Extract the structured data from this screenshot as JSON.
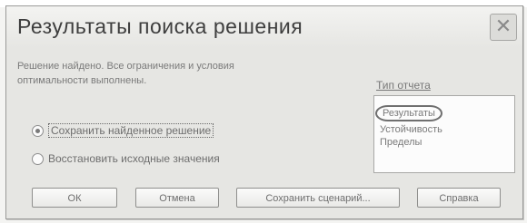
{
  "dialog": {
    "title": "Результаты поиска решения",
    "close_glyph": "✕",
    "message_line1": "Решение найдено. Все ограничения и условия",
    "message_line2": "оптимальности выполнены."
  },
  "options": {
    "keep_solution": "Сохранить найденное решение",
    "restore_values": "Восстановить исходные значения",
    "selected": "keep_solution"
  },
  "report": {
    "label": "Тип отчета",
    "items": [
      "Результаты",
      "Устойчивость",
      "Пределы"
    ]
  },
  "buttons": {
    "ok": "ОК",
    "cancel": "Отмена",
    "save_scenario": "Сохранить сценарий...",
    "help": "Справка"
  }
}
